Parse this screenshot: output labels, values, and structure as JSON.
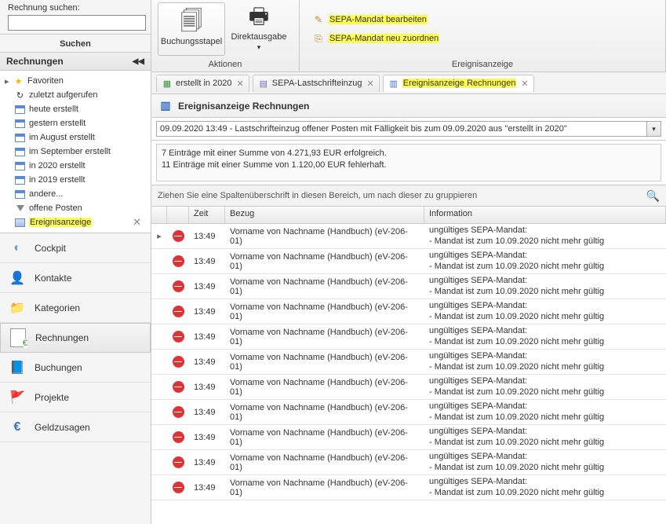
{
  "sidebar": {
    "search_label": "Rechnung suchen:",
    "search_value": "",
    "search_btn": "Suchen",
    "panel_title": "Rechnungen",
    "tree": {
      "favoriten": "Favoriten",
      "items": [
        "zuletzt aufgerufen",
        "heute erstellt",
        "gestern erstellt",
        "im August erstellt",
        "im September erstellt",
        "in 2020 erstellt",
        "in 2019 erstellt",
        "andere...",
        "offene Posten",
        "Ereignisanzeige"
      ]
    },
    "nav": [
      "Cockpit",
      "Kontakte",
      "Kategorien",
      "Rechnungen",
      "Buchungen",
      "Projekte",
      "Geldzusagen"
    ]
  },
  "ribbon": {
    "aktionen": {
      "title": "Aktionen",
      "buchungsstapel": "Buchungsstapel",
      "direktausgabe": "Direktausgabe"
    },
    "ereignis": {
      "title": "Ereignisanzeige",
      "edit": "SEPA-Mandat bearbeiten",
      "assign": "SEPA-Mandat neu zuordnen"
    }
  },
  "tabs": [
    {
      "label": "erstellt in 2020"
    },
    {
      "label": "SEPA-Lastschrifteinzug"
    },
    {
      "label": "Ereignisanzeige Rechnungen"
    }
  ],
  "view_title": "Ereignisanzeige Rechnungen",
  "dropdown": "09.09.2020 13:49 - Lastschrifteinzug offener Posten mit Fälligkeit bis zum 09.09.2020 aus \"erstellt in 2020\"",
  "summary": {
    "line1": "7 Einträge mit einer Summe von 4.271,93 EUR erfolgreich.",
    "line2": "11 Einträge mit einer Summe von 1.120,00 EUR fehlerhaft."
  },
  "group_hint": "Ziehen Sie eine Spaltenüberschrift in diesen Bereich, um nach dieser zu gruppieren",
  "columns": {
    "zeit": "Zeit",
    "bezug": "Bezug",
    "info": "Information"
  },
  "row_template": {
    "zeit": "13:49",
    "bezug": "Vorname von Nachname (Handbuch) (eV-206-01)",
    "info1": "ungültiges SEPA-Mandat:",
    "info2": "- Mandat ist zum 10.09.2020 nicht mehr gültig"
  },
  "row_count": 11
}
